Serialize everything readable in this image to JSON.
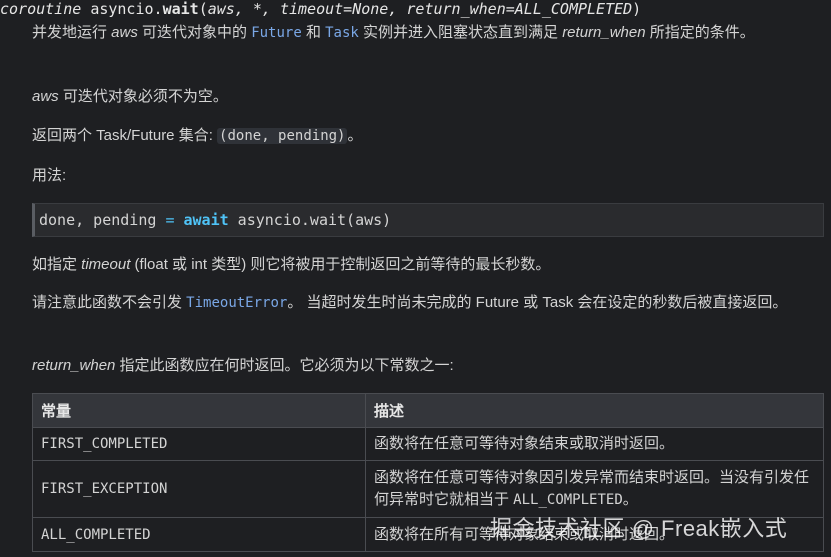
{
  "signature": {
    "keyword": "coroutine",
    "module": "asyncio.",
    "name": "wait",
    "open": "(",
    "params": "aws, *, timeout=None, return_when=ALL_COMPLETED",
    "close": ")"
  },
  "para1": {
    "t1": "并发地运行 ",
    "aws": "aws",
    "t2": " 可迭代对象中的 ",
    "future": "Future",
    "t3": " 和 ",
    "task": "Task",
    "t4": " 实例并进入阻塞状态直到满足 ",
    "return_when": "return_when",
    "t5": " 所指定的条件。"
  },
  "para2": {
    "aws": "aws",
    "text": " 可迭代对象必须不为空。"
  },
  "para3": {
    "text": "返回两个 Task/Future 集合: ",
    "code": "(done, pending)",
    "tail": "。"
  },
  "para4": {
    "text": "用法:"
  },
  "code_example": {
    "part1": "done, pending ",
    "eq": "=",
    "space": " ",
    "await": "await",
    "part2": " asyncio.wait(aws)"
  },
  "para5": {
    "t1": "如指定 ",
    "timeout": "timeout",
    "t2": " (float 或 int 类型) 则它将被用于控制返回之前等待的最长秒数。"
  },
  "para6": {
    "t1": "请注意此函数不会引发 ",
    "error": "TimeoutError",
    "t2": "。 当超时发生时尚未完成的 Future 或 Task 会在设定的秒数后被直接返回。"
  },
  "para7": {
    "return_when": "return_when",
    "text": " 指定此函数应在何时返回。它必须为以下常数之一:"
  },
  "table": {
    "headers": [
      "常量",
      "描述"
    ],
    "rows": [
      {
        "constant": "FIRST_COMPLETED",
        "desc": "函数将在任意可等待对象结束或取消时返回。"
      },
      {
        "constant": "FIRST_EXCEPTION",
        "desc": "函数将在任意可等待对象因引发异常而结束时返回。当没有引发任何异常时它就相当于 ",
        "desc_code": "ALL_COMPLETED",
        "desc_tail": "。"
      },
      {
        "constant": "ALL_COMPLETED",
        "desc": "函数将在所有可等待对象结束或取消时返回。"
      }
    ]
  },
  "watermark": "掘金技术社区 @ Freak嵌入式"
}
